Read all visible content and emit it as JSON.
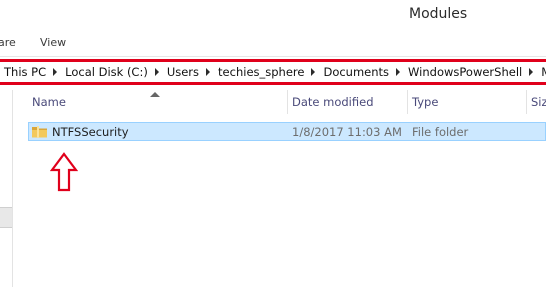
{
  "window": {
    "title": "Modules"
  },
  "ribbon": {
    "tabs": [
      {
        "label": "are"
      },
      {
        "label": "View"
      }
    ]
  },
  "address": {
    "crumbs": [
      "This PC",
      "Local Disk (C:)",
      "Users",
      "techies_sphere",
      "Documents",
      "WindowsPowerShell",
      "Mo"
    ]
  },
  "columns": {
    "name": "Name",
    "date_modified": "Date modified",
    "type": "Type",
    "size": "Siz"
  },
  "files": [
    {
      "name": "NTFSSecurity",
      "date_modified": "1/8/2017 11:03 AM",
      "type": "File folder",
      "selected": true,
      "icon": "folder-icon"
    }
  ],
  "colors": {
    "selection_bg": "#cce8ff",
    "selection_border": "#99d1ff",
    "annotation_red": "#e0001b",
    "folder_yellow": "#e8b84a"
  }
}
